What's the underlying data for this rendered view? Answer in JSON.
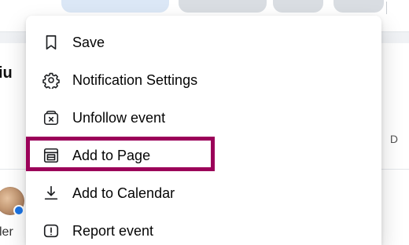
{
  "menu": {
    "items": [
      {
        "label": "Save",
        "icon": "bookmark-icon"
      },
      {
        "label": "Notification Settings",
        "icon": "gear-icon"
      },
      {
        "label": "Unfollow event",
        "icon": "unfollow-icon"
      },
      {
        "label": "Add to Page",
        "icon": "page-layout-icon"
      },
      {
        "label": "Add to Calendar",
        "icon": "download-calendar-icon"
      },
      {
        "label": "Report event",
        "icon": "report-icon"
      }
    ],
    "highlighted_index": 3
  },
  "background": {
    "left_text_fragment": "iu",
    "right_text_fragment": "D",
    "bottom_left_text_fragment": "ler"
  },
  "colors": {
    "highlight_border": "#9b0059",
    "menu_bg": "#ffffff",
    "page_bg": "#f0f2f5",
    "text": "#050505",
    "icon": "#1c1e21",
    "verified_badge": "#1b74e4"
  }
}
